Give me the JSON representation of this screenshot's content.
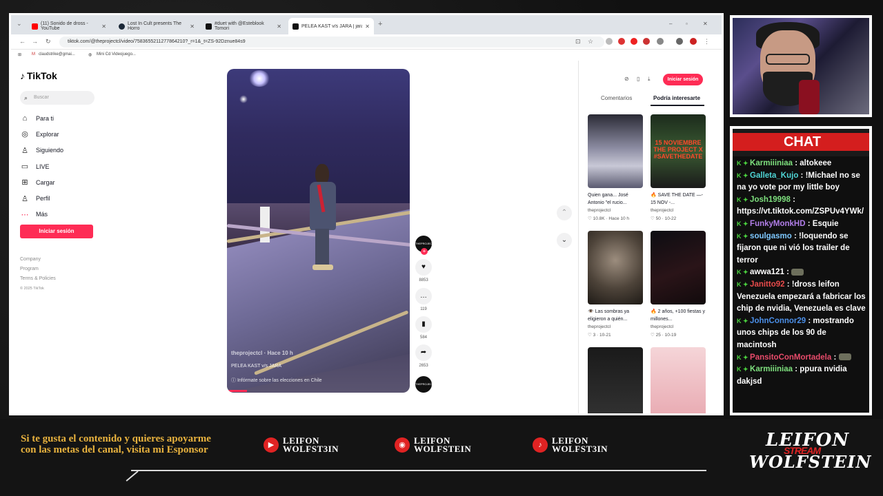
{
  "browser": {
    "tabs": [
      {
        "label": "(11) Sonido de dross - YouTube",
        "color": "#ff0000"
      },
      {
        "label": "Lost In Cult presents The Horro",
        "color": "#1b2838"
      },
      {
        "label": "#duet with @Esteblook Tomori",
        "color": "#111111"
      },
      {
        "label": "PELEA KAST v/s JARA | jara vs k",
        "color": "#111111"
      }
    ],
    "add_tab": "+",
    "url": "tiktok.com/@theprojectcl/video/7583655211277864210?_r=1&_t=ZS-92Dznue84s9",
    "bookmarks": [
      "claudstrike@gmai...",
      "Mini Cd Videojuego..."
    ]
  },
  "tiktok": {
    "logo": "TikTok",
    "search_placeholder": "Buscar",
    "nav": [
      {
        "label": "Para ti",
        "icon": "home-icon",
        "glyph": "⌂"
      },
      {
        "label": "Explorar",
        "icon": "compass-icon",
        "glyph": "◎"
      },
      {
        "label": "Siguiendo",
        "icon": "following-icon",
        "glyph": "♙"
      },
      {
        "label": "LIVE",
        "icon": "live-icon",
        "glyph": "▭"
      },
      {
        "label": "Cargar",
        "icon": "upload-icon",
        "glyph": "⊞"
      },
      {
        "label": "Perfil",
        "icon": "profile-icon",
        "glyph": "♙"
      },
      {
        "label": "Más",
        "icon": "more-icon",
        "glyph": "⋯"
      }
    ],
    "login_button": "Iniciar sesión",
    "footer": [
      "Company",
      "Program",
      "Terms & Policies"
    ],
    "copyright": "© 2025 TikTok",
    "video": {
      "user": "theprojectcl · Hace 10 h",
      "caption": "PELEA KAST v/s JARA",
      "info": "Infórmate sobre las elecciones en Chile",
      "progress_fraction": 0.11
    },
    "actions": {
      "likes": "8853",
      "comments": "119",
      "saves": "584",
      "shares": "2653",
      "avatar_text": "THEPROJECT"
    },
    "right": {
      "login_button": "Iniciar sesión",
      "tabs": [
        "Comentarios",
        "Podría interesarte"
      ],
      "cards": [
        {
          "desc": "Quien gana... José Antonio \"el rucio...",
          "user": "theprojectcl",
          "stats": "♡ 10.8K · Hace 10 h"
        },
        {
          "desc": "🔥 SAVE THE DATE —- 15 NOV -...",
          "user": "theprojectcl",
          "stats": "♡ 50 · 10-22"
        },
        {
          "desc": "👁️ Las sombras ya eligieron a quién...",
          "user": "theprojectcl",
          "stats": "♡ 3 · 10-21"
        },
        {
          "desc": "🔥 2 años, +100 fiestas y millones...",
          "user": "theprojectcl",
          "stats": "♡ 25 · 10-19"
        }
      ],
      "card2_overlay": "15 NOVIEMBRE THE PROJECT X #SAVETHEDATE"
    }
  },
  "chat": {
    "title": "CHAT",
    "messages": [
      {
        "user": "Karmiiiniaa",
        "color": "#7ee07e",
        "text": "altokeee"
      },
      {
        "user": "Galleta_Kujo",
        "color": "#4fd6d6",
        "text": "!Michael no se na yo vote por my little boy"
      },
      {
        "user": "Josh19998",
        "color": "#7ee07e",
        "text": "https://vt.tiktok.com/ZSPUv4YWk/"
      },
      {
        "user": "FunkyMonkHD",
        "color": "#b17ee8",
        "text": "Esquie"
      },
      {
        "user": "soulgasmo",
        "color": "#7ec8ff",
        "text": "!loquendo se fijaron que ni vió los trailer de terror"
      },
      {
        "user": "awwa121",
        "color": "#ffffff",
        "text": ""
      },
      {
        "user": "Janitto92",
        "color": "#e84b4b",
        "text": "!dross leifon Venezuela empezará a fabricar los chip de nvidia, Venezuela es clave"
      },
      {
        "user": "JohnConnor29",
        "color": "#4b8fe8",
        "text": "mostrando unos chips de los 90 de macintosh"
      },
      {
        "user": "PansitoConMortadela",
        "color": "#e84b6b",
        "text": ""
      },
      {
        "user": "Karmiiiniaa",
        "color": "#7ee07e",
        "text": "ppura nvidia dakjsd"
      }
    ]
  },
  "bottom": {
    "sponsor_text": "Si te gusta el contenido y quieres apoyarme con las metas del canal, visita mi Esponsor",
    "socials": [
      {
        "icon": "youtube-icon",
        "glyph": "▶",
        "line1": "LEIFON",
        "line2": "WOLFST3IN"
      },
      {
        "icon": "instagram-icon",
        "glyph": "◉",
        "line1": "LEIFON",
        "line2": "WOLFSTEIN"
      },
      {
        "icon": "tiktok-icon",
        "glyph": "♪",
        "line1": "LEIFON",
        "line2": "WOLFST3IN"
      }
    ],
    "brand_line1": "LEIFON",
    "brand_line2": "WOLFSTEIN",
    "brand_stamp": "STREAM"
  },
  "colors": {
    "tiktok_red": "#fe2c55",
    "chat_red": "#d41e1e",
    "sponsor_gold": "#e8b23e"
  }
}
